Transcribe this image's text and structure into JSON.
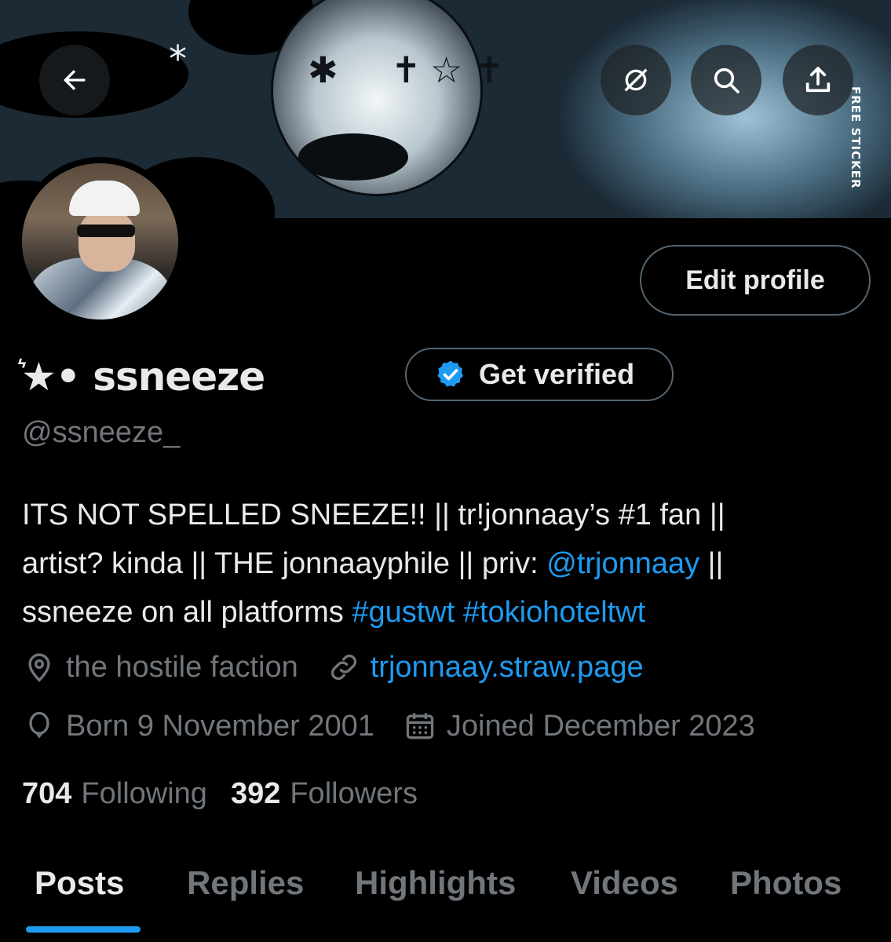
{
  "header": {
    "back_icon": "arrow-left-icon",
    "grok_icon": "slash-circle-icon",
    "search_icon": "search-icon",
    "share_icon": "share-icon",
    "banner_text": "FREE STICKER"
  },
  "profile": {
    "display_name": "͛★• ssneeze",
    "handle": "@ssneeze_",
    "edit_label": "Edit profile",
    "verify_label": "Get verified",
    "bio_parts": {
      "line1": "ITS NOT SPELLED SNEEZE!! || tr!jonnaay’s #1 fan ||",
      "line2_a": "artist? kinda || THE jonnaayphile || priv: ",
      "line2_mention": "@trjonnaay",
      "line2_b": " ||",
      "line3_a": "ssneeze on all platforms ",
      "line3_tags": "#gustwt #tokiohoteltwt"
    },
    "location": "the hostile faction",
    "website": "trjonnaay.straw.page",
    "birthday": "Born 9 November 2001",
    "joined": "Joined December 2023",
    "following_count": "704",
    "following_label": "Following",
    "followers_count": "392",
    "followers_label": "Followers"
  },
  "tabs": [
    {
      "label": "Posts",
      "active": true
    },
    {
      "label": "Replies",
      "active": false
    },
    {
      "label": "Highlights",
      "active": false
    },
    {
      "label": "Videos",
      "active": false
    },
    {
      "label": "Photos",
      "active": false
    }
  ],
  "colors": {
    "accent": "#1d9bf0",
    "muted": "#71767b",
    "text": "#e7e9ea",
    "background": "#000000",
    "border": "#536471"
  }
}
